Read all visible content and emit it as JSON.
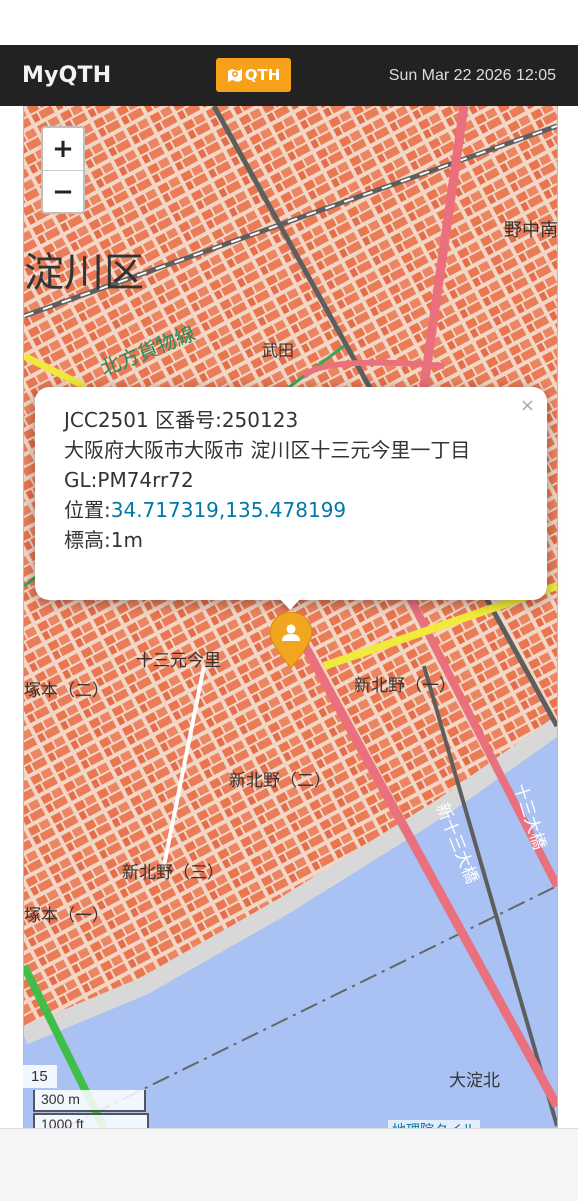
{
  "navbar": {
    "brand": "MyQTH",
    "qth_button_label": "QTH",
    "qth_button_icon": "map-marker-icon",
    "datetime": "Sun Mar 22 2026 12:05"
  },
  "map": {
    "zoom_in_label": "+",
    "zoom_out_label": "−",
    "zoom_level": "15",
    "scale_metric": "300 m",
    "scale_imperial": "1000 ft",
    "attribution": "地理院タイル",
    "labels": [
      "淀川区",
      "北方貨物線",
      "武田",
      "野中南",
      "十三元今里",
      "新北野（一）",
      "塚本（二）",
      "新北野（二）",
      "新北野（三）",
      "塚本（一）",
      "十三大橋",
      "新十三大橋",
      "大淀北"
    ],
    "colors": {
      "land": "#e6795a",
      "river": "#a9c1f3",
      "rail": "#5e5e5e",
      "road_primary": "#e9707c",
      "road_secondary": "#f1ea3c",
      "road_green": "#3fbf48"
    }
  },
  "popup": {
    "close_label": "×",
    "line1": "JCC2501 区番号:250123",
    "line2": "大阪府大阪市大阪市 淀川区十三元今里一丁目",
    "line3": "GL:PM74rr72",
    "position_label": "位置:",
    "position_value": "34.717319,135.478199",
    "elevation": "標高:1m"
  }
}
